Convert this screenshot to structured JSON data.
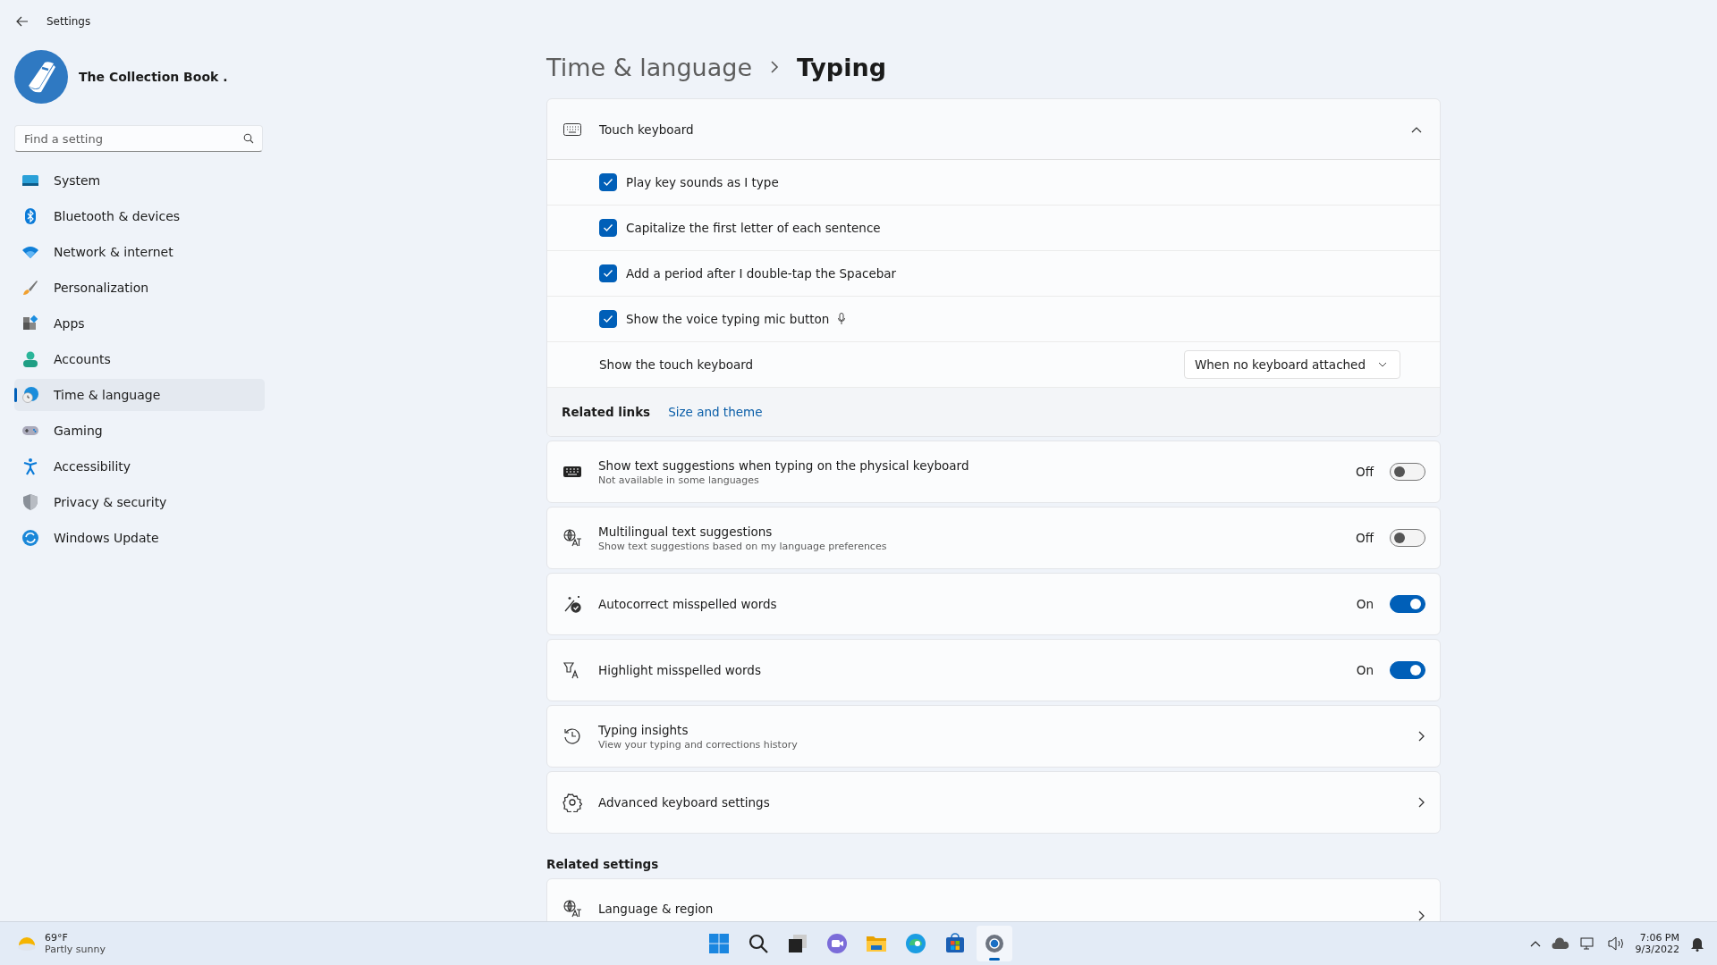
{
  "window": {
    "title": "Settings"
  },
  "account": {
    "name": "The Collection Book ."
  },
  "search": {
    "placeholder": "Find a setting"
  },
  "sidebar": {
    "items": [
      {
        "label": "System",
        "kind": "system",
        "selected": false
      },
      {
        "label": "Bluetooth & devices",
        "kind": "bluetooth",
        "selected": false
      },
      {
        "label": "Network & internet",
        "kind": "network",
        "selected": false
      },
      {
        "label": "Personalization",
        "kind": "brush",
        "selected": false
      },
      {
        "label": "Apps",
        "kind": "apps",
        "selected": false
      },
      {
        "label": "Accounts",
        "kind": "accounts",
        "selected": false
      },
      {
        "label": "Time & language",
        "kind": "time",
        "selected": true
      },
      {
        "label": "Gaming",
        "kind": "gaming",
        "selected": false
      },
      {
        "label": "Accessibility",
        "kind": "accessibility",
        "selected": false
      },
      {
        "label": "Privacy & security",
        "kind": "privacy",
        "selected": false
      },
      {
        "label": "Windows Update",
        "kind": "update",
        "selected": false
      }
    ]
  },
  "breadcrumb": {
    "parent": "Time & language",
    "current": "Typing"
  },
  "touch_keyboard": {
    "title": "Touch keyboard",
    "expanded": true,
    "options": [
      {
        "label": "Play key sounds as I type",
        "checked": true,
        "mic": false
      },
      {
        "label": "Capitalize the first letter of each sentence",
        "checked": true,
        "mic": false
      },
      {
        "label": "Add a period after I double-tap the Spacebar",
        "checked": true,
        "mic": false
      },
      {
        "label": "Show the voice typing mic button",
        "checked": true,
        "mic": true
      }
    ],
    "show_keyboard": {
      "label": "Show the touch keyboard",
      "value": "When no keyboard attached"
    },
    "related": {
      "label": "Related links",
      "link": "Size and theme"
    }
  },
  "settings": [
    {
      "kind": "toggle",
      "title": "Show text suggestions when typing on the physical keyboard",
      "subtitle": "Not available in some languages",
      "on": false,
      "state": "Off"
    },
    {
      "kind": "toggle",
      "title": "Multilingual text suggestions",
      "subtitle": "Show text suggestions based on my language preferences",
      "on": false,
      "state": "Off"
    },
    {
      "kind": "toggle",
      "title": "Autocorrect misspelled words",
      "on": true,
      "state": "On"
    },
    {
      "kind": "toggle",
      "title": "Highlight misspelled words",
      "on": true,
      "state": "On"
    },
    {
      "kind": "link",
      "title": "Typing insights",
      "subtitle": "View your typing and corrections history"
    },
    {
      "kind": "link",
      "title": "Advanced keyboard settings"
    }
  ],
  "related_settings": {
    "heading": "Related settings",
    "items": [
      {
        "title": "Language & region"
      }
    ]
  },
  "taskbar": {
    "weather": {
      "temperature": "69°F",
      "condition": "Partly sunny"
    },
    "apps": [
      {
        "kind": "start",
        "selected": false
      },
      {
        "kind": "search",
        "selected": false
      },
      {
        "kind": "taskview",
        "selected": false
      },
      {
        "kind": "chat",
        "selected": false
      },
      {
        "kind": "explorer",
        "selected": false
      },
      {
        "kind": "edge",
        "selected": false
      },
      {
        "kind": "store",
        "selected": false
      },
      {
        "kind": "settings",
        "selected": true
      }
    ],
    "clock": {
      "time": "7:06 PM",
      "date": "9/3/2022"
    }
  }
}
